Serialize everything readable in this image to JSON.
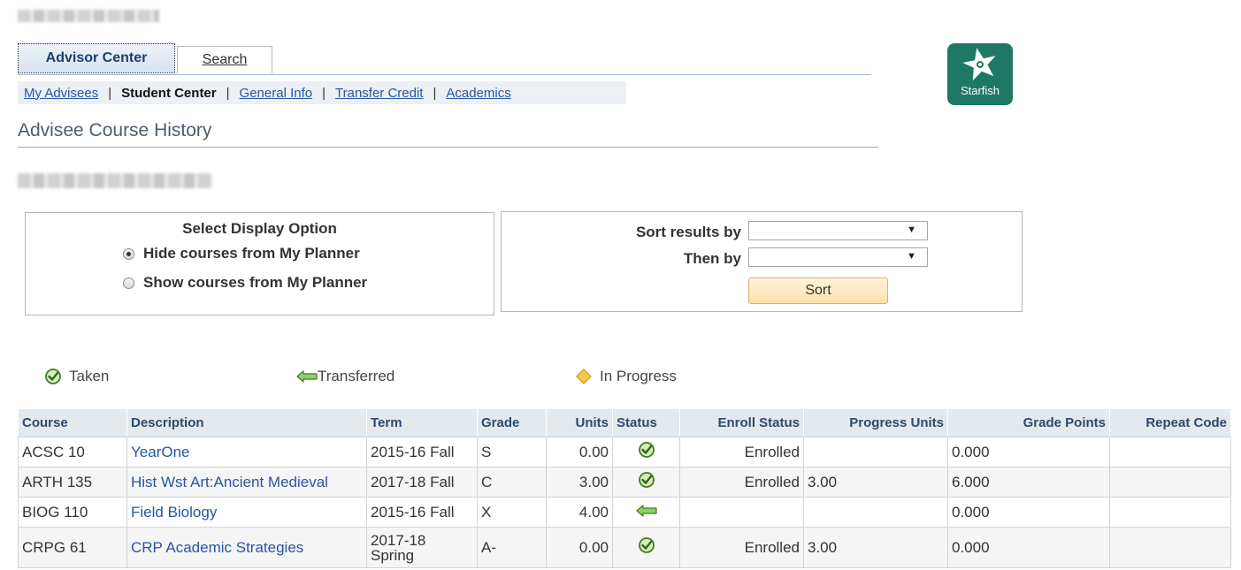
{
  "tabs": [
    {
      "label": "Advisor Center",
      "active": true
    },
    {
      "label": "Search",
      "active": false
    }
  ],
  "subnav": [
    {
      "label": "My Advisees",
      "current": false
    },
    {
      "label": "Student Center",
      "current": true
    },
    {
      "label": "General Info",
      "current": false
    },
    {
      "label": "Transfer Credit",
      "current": false
    },
    {
      "label": "Academics",
      "current": false
    }
  ],
  "subnav_separator": "|",
  "page_title": "Advisee Course History",
  "starfish": {
    "label": "Starfish",
    "bg_color": "#1f7864"
  },
  "display_option": {
    "title": "Select Display Option",
    "options": [
      {
        "label": "Hide courses from My Planner",
        "selected": true
      },
      {
        "label": "Show courses from My Planner",
        "selected": false
      }
    ]
  },
  "sort": {
    "sort_by_label": "Sort results by",
    "then_by_label": "Then by",
    "sort_by_value": "",
    "then_by_value": "",
    "button_label": "Sort"
  },
  "legend": {
    "taken": "Taken",
    "transferred": "Transferred",
    "in_progress": "In Progress"
  },
  "table": {
    "headers": [
      "Course",
      "Description",
      "Term",
      "Grade",
      "Units",
      "Status",
      "Enroll Status",
      "Progress Units",
      "Grade Points",
      "Repeat Code"
    ],
    "rows": [
      {
        "course": "ACSC 10",
        "description": "YearOne",
        "term": "2015-16 Fall",
        "grade": "S",
        "units": "0.00",
        "status": "taken-icon",
        "enroll_status": "Enrolled",
        "progress_units": "",
        "grade_points": "0.000",
        "repeat_code": ""
      },
      {
        "course": "ARTH 135",
        "description": "Hist Wst Art:Ancient Medieval",
        "term": "2017-18 Fall",
        "grade": "C",
        "units": "3.00",
        "status": "taken-icon",
        "enroll_status": "Enrolled",
        "progress_units": "3.00",
        "grade_points": "6.000",
        "repeat_code": ""
      },
      {
        "course": "BIOG 110",
        "description": "Field Biology",
        "term": "2015-16 Fall",
        "grade": "X",
        "units": "4.00",
        "status": "transferred-icon",
        "enroll_status": "",
        "progress_units": "",
        "grade_points": "0.000",
        "repeat_code": ""
      },
      {
        "course": "CRPG 61",
        "description": "CRP Academic Strategies",
        "term": "2017-18 Spring",
        "grade": "A-",
        "units": "0.00",
        "status": "taken-icon",
        "enroll_status": "Enrolled",
        "progress_units": "3.00",
        "grade_points": "0.000",
        "repeat_code": ""
      }
    ]
  },
  "colors": {
    "link": "#2457a0",
    "taken_icon": "#5aa02c",
    "transferred_icon": "#5aa02c",
    "in_progress_icon": "#f5c542",
    "header_bg": "#e4e9ee"
  }
}
